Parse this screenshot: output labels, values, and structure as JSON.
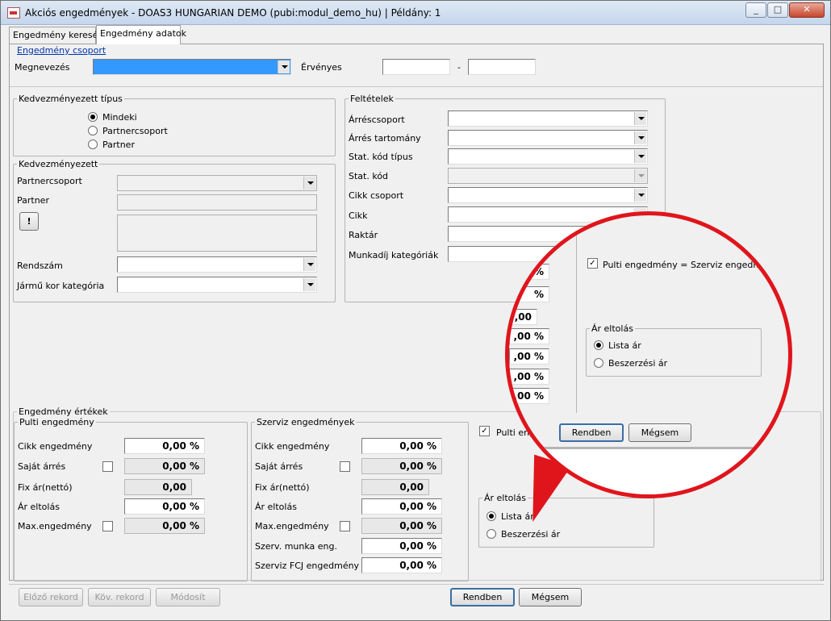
{
  "window": {
    "title": "Akciós engedmények - DOAS3 HUNGARIAN DEMO (pubi:modul_demo_hu) | Példány: 1",
    "minimize": "_",
    "maximize": "□",
    "close": "✕"
  },
  "tabs": [
    "Engedmény keresés",
    "Engedmény adatok"
  ],
  "header": {
    "group_link": "Engedmény csoport",
    "name_label": "Megnevezés",
    "valid_label": "Érvényes",
    "dash": "-"
  },
  "beneficiary_type": {
    "title": "Kedvezményezett típus",
    "options": [
      "Mindeki",
      "Partnercsoport",
      "Partner"
    ],
    "selected": 0
  },
  "beneficiary": {
    "title": "Kedvezményezett",
    "partner_group": "Partnercsoport",
    "partner": "Partner",
    "alert_button": "!",
    "plate": "Rendszám",
    "vehicle_age": "Jármű kor kategória"
  },
  "conditions": {
    "title": "Feltételek",
    "rows": [
      "Árréscsoport",
      "Árrés tartomány",
      "Stat. kód típus",
      "Stat. kód",
      "Cikk csoport",
      "Cikk",
      "Raktár",
      "Munkadíj kategóriák"
    ],
    "ellipsis": "..."
  },
  "discount_values": {
    "title": "Engedmény értékek",
    "counter": {
      "title": "Pulti engedmény",
      "rows": [
        {
          "label": "Cikk engedmény",
          "value": "0,00 %"
        },
        {
          "label": "Saját árrés",
          "value": "0,00 %"
        },
        {
          "label": "Fix ár(nettó)",
          "value": "0,00"
        },
        {
          "label": "Ár eltolás",
          "value": "0,00 %"
        },
        {
          "label": "Max.engedmény",
          "value": "0,00 %"
        }
      ]
    },
    "service": {
      "title": "Szerviz  engedmények",
      "rows": [
        {
          "label": "Cikk engedmény",
          "value": "0,00 %"
        },
        {
          "label": "Saját árrés",
          "value": "0,00 %"
        },
        {
          "label": "Fix ár(nettó)",
          "value": "0,00"
        },
        {
          "label": "Ár eltolás",
          "value": "0,00 %"
        },
        {
          "label": "Max.engedmény",
          "value": "0,00 %"
        },
        {
          "label": "Szerv. munka eng.",
          "value": "0,00 %"
        },
        {
          "label": "Szerviz FCJ engedmény",
          "value": "0,00 %"
        }
      ]
    },
    "pulti_eq_label": "Pulti eng",
    "price_shift": {
      "title": "Ár eltolás",
      "options": [
        "Lista ár",
        "Beszerzési ár"
      ],
      "selected": 0
    }
  },
  "zoom": {
    "check_label": "Pulti engedmény = Szerviz  engedmény",
    "values": [
      "%",
      "%",
      ",00",
      ",00 %",
      ",00 %",
      ",00 %",
      ",00 %"
    ],
    "price_shift_title": "Ár eltolás",
    "price_options": [
      "Lista ár",
      "Beszerzési ár"
    ],
    "ok": "Rendben",
    "cancel": "Mégsem"
  },
  "footer": {
    "prev": "Előző rekord",
    "next": "Köv. rekord",
    "modify": "Módosít",
    "ok": "Rendben",
    "cancel": "Mégsem"
  }
}
